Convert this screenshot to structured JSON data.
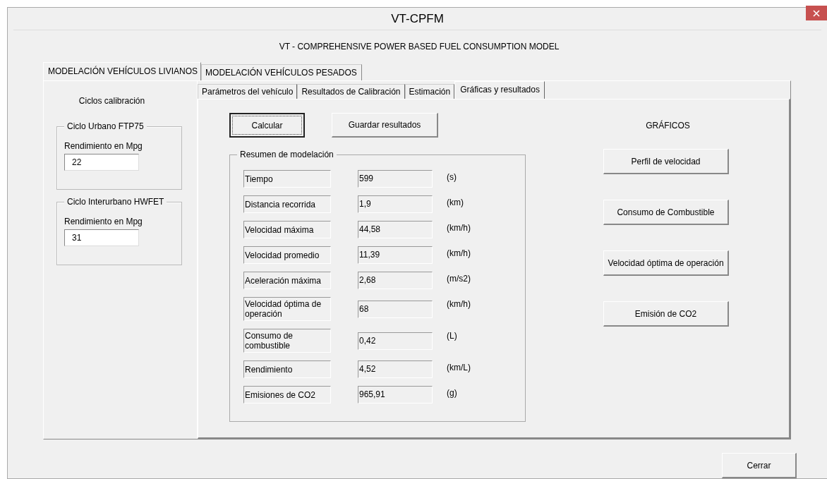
{
  "window": {
    "title": "VT-CPFM"
  },
  "subtitle": "VT - COMPREHENSIVE POWER BASED FUEL CONSUMPTION MODEL",
  "main_tabs": [
    {
      "label": "MODELACIÓN VEHÍCULOS LIVIANOS",
      "selected": true
    },
    {
      "label": "MODELACIÓN VEHÍCULOS PESADOS",
      "selected": false
    }
  ],
  "left_panel": {
    "heading": "Ciclos calibración",
    "groups": [
      {
        "title": "Ciclo Urbano FTP75",
        "field_label": "Rendimiento en Mpg",
        "value": "22"
      },
      {
        "title": "Ciclo Interurbano HWFET",
        "field_label": "Rendimiento en Mpg",
        "value": "31"
      }
    ]
  },
  "sub_tabs": [
    {
      "label": "Parámetros del vehículo",
      "selected": false
    },
    {
      "label": "Resultados de Calibración",
      "selected": false
    },
    {
      "label": "Estimación",
      "selected": false
    },
    {
      "label": "Gráficas y resultados",
      "selected": true
    }
  ],
  "action_buttons": [
    {
      "label": "Calcular",
      "focused": true
    },
    {
      "label": "Guardar resultados",
      "focused": false
    }
  ],
  "summary": {
    "title": "Resumen de modelación",
    "rows": [
      {
        "label": "Tiempo",
        "value": "599",
        "unit": "(s)"
      },
      {
        "label": "Distancia recorrida",
        "value": "1,9",
        "unit": "(km)"
      },
      {
        "label": "Velocidad máxima",
        "value": "44,58",
        "unit": "(km/h)"
      },
      {
        "label": "Velocidad promedio",
        "value": "11,39",
        "unit": "(km/h)"
      },
      {
        "label": "Aceleración máxima",
        "value": "2,68",
        "unit": "(m/s2)"
      },
      {
        "label": "Velocidad óptima de operación",
        "value": "68",
        "unit": "(km/h)"
      },
      {
        "label": "Consumo de combustible",
        "value": "0,42",
        "unit": "(L)"
      },
      {
        "label": "Rendimiento",
        "value": "4,52",
        "unit": "(km/L)"
      },
      {
        "label": "Emisiones de CO2",
        "value": "965,91",
        "unit": "(g)"
      }
    ]
  },
  "charts_panel": {
    "heading": "GRÁFICOS",
    "buttons": [
      "Perfil de velocidad",
      "Consumo de Combustible",
      "Velocidad óptima de operación",
      "Emisión de CO2"
    ]
  },
  "close_button": "Cerrar"
}
